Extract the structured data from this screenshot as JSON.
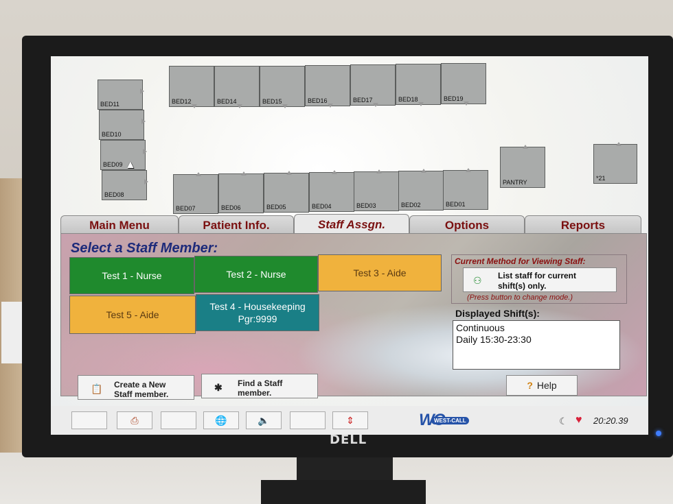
{
  "floorplan": {
    "rooms_top": [
      "BED12",
      "BED14",
      "BED15",
      "BED16",
      "BED17",
      "BED18",
      "BED19"
    ],
    "rooms_left": [
      "BED11",
      "BED10",
      "BED09",
      "BED08"
    ],
    "rooms_bottom": [
      "BED07",
      "BED06",
      "BED05",
      "BED04",
      "BED03",
      "BED02",
      "BED01"
    ],
    "pantry": "PANTRY",
    "room21": "*21"
  },
  "tabs": [
    {
      "label": "Main Menu"
    },
    {
      "label": "Patient Info."
    },
    {
      "label": "Staff Assgn."
    },
    {
      "label": "Options"
    },
    {
      "label": "Reports"
    }
  ],
  "active_tab": "Staff Assgn.",
  "panel": {
    "title": "Select a Staff Member:",
    "staff": [
      {
        "label": "Test 1 - Nurse",
        "color": "#1f8a2d"
      },
      {
        "label": "Test 2 - Nurse",
        "color": "#1f8a2d"
      },
      {
        "label": "Test 3 - Aide",
        "color": "#f0b23d"
      },
      {
        "label": "Test 5 - Aide",
        "color": "#f0b23d"
      },
      {
        "label": "Test 4 - Housekeeping",
        "sub": "Pgr:9999",
        "color": "#1a7f86"
      }
    ],
    "method": {
      "title": "Current Method for Viewing Staff:",
      "button_line1": "List staff for current",
      "button_line2": "shift(s) only.",
      "hint": "(Press button to change mode.)",
      "icon": "person-icon"
    },
    "shifts": {
      "title": "Displayed Shift(s):",
      "line1": "Continuous",
      "line2": "Daily 15:30-23:30"
    },
    "create_button": {
      "line1": "Create a New",
      "line2": "Staff member.",
      "icon": "clipboard-icon"
    },
    "find_button": {
      "line1": "Find a Staff",
      "line2": "member.",
      "icon": "search-people-icon"
    },
    "help_button": {
      "label": "Help",
      "icon": "?"
    }
  },
  "taskbar": {
    "logo_text": "WEST-CALL",
    "logo_mark": "WC",
    "clock": "20:20.39",
    "icons": [
      "blank",
      "printer-icon",
      "blank",
      "globe-icon",
      "speaker-icon",
      "blank",
      "updown-arrows-icon"
    ]
  },
  "monitor_brand": "DELL"
}
